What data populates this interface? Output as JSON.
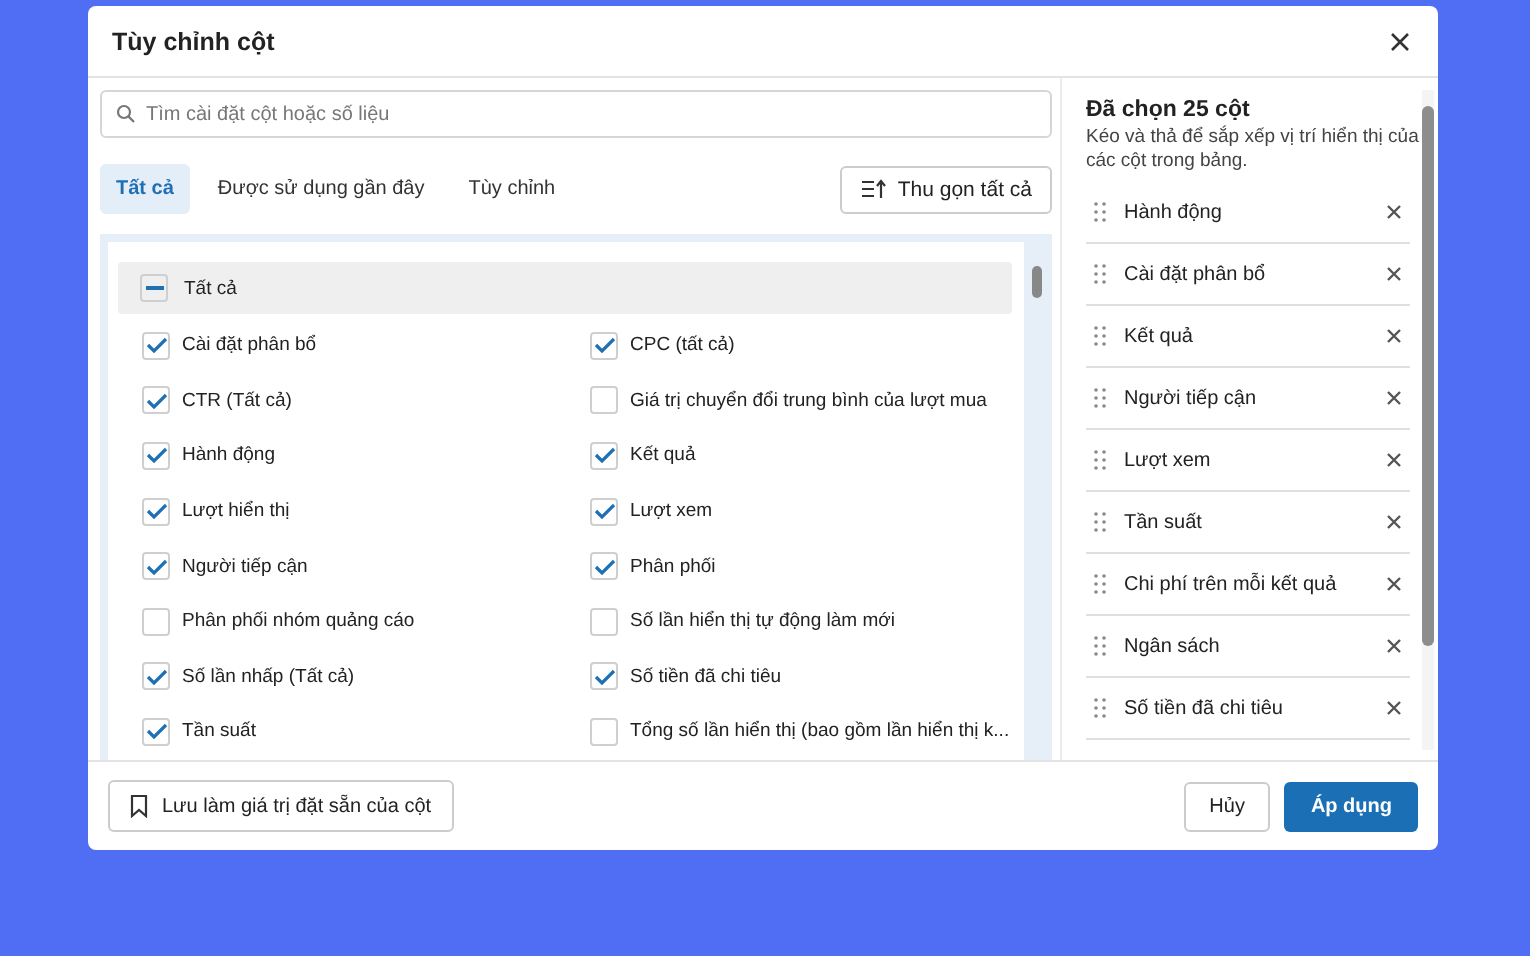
{
  "dialog": {
    "title": "Tùy chỉnh cột"
  },
  "search": {
    "placeholder": "Tìm cài đặt cột hoặc số liệu"
  },
  "tabs": [
    {
      "label": "Tất cả",
      "selected": true
    },
    {
      "label": "Được sử dụng gần đây",
      "selected": false
    },
    {
      "label": "Tùy chỉnh",
      "selected": false
    }
  ],
  "collapse_button": "Thu gọn tất cả",
  "select_all": {
    "label": "Tất cả",
    "indeterminate": true
  },
  "options": [
    {
      "label": "Cài đặt phân bổ",
      "checked": true
    },
    {
      "label": "CPC (tất cả)",
      "checked": true
    },
    {
      "label": "CTR (Tất cả)",
      "checked": true
    },
    {
      "label": "Giá trị chuyển đổi trung bình của lượt mua",
      "checked": false
    },
    {
      "label": "Hành động",
      "checked": true
    },
    {
      "label": "Kết quả",
      "checked": true
    },
    {
      "label": "Lượt hiển thị",
      "checked": true
    },
    {
      "label": "Lượt xem",
      "checked": true
    },
    {
      "label": "Người tiếp cận",
      "checked": true
    },
    {
      "label": "Phân phối",
      "checked": true
    },
    {
      "label": "Phân phối nhóm quảng cáo",
      "checked": false
    },
    {
      "label": "Số lần hiển thị tự động làm mới",
      "checked": false
    },
    {
      "label": "Số lần nhấp (Tất cả)",
      "checked": true
    },
    {
      "label": "Số tiền đã chi tiêu",
      "checked": true
    },
    {
      "label": "Tần suất",
      "checked": true
    },
    {
      "label": "Tổng số lần hiển thị (bao gồm lần hiển thị k...",
      "checked": false
    }
  ],
  "selected_panel": {
    "title": "Đã chọn 25 cột",
    "hint": "Kéo và thả để sắp xếp vị trí hiển thị của các cột trong bảng.",
    "items": [
      "Hành động",
      "Cài đặt phân bổ",
      "Kết quả",
      "Người tiếp cận",
      "Lượt xem",
      "Tần suất",
      "Chi phí trên mỗi kết quả",
      "Ngân sách",
      "Số tiền đã chi tiêu"
    ]
  },
  "footer": {
    "save_preset": "Lưu làm giá trị đặt sẵn của cột",
    "cancel": "Hủy",
    "apply": "Áp dụng"
  }
}
